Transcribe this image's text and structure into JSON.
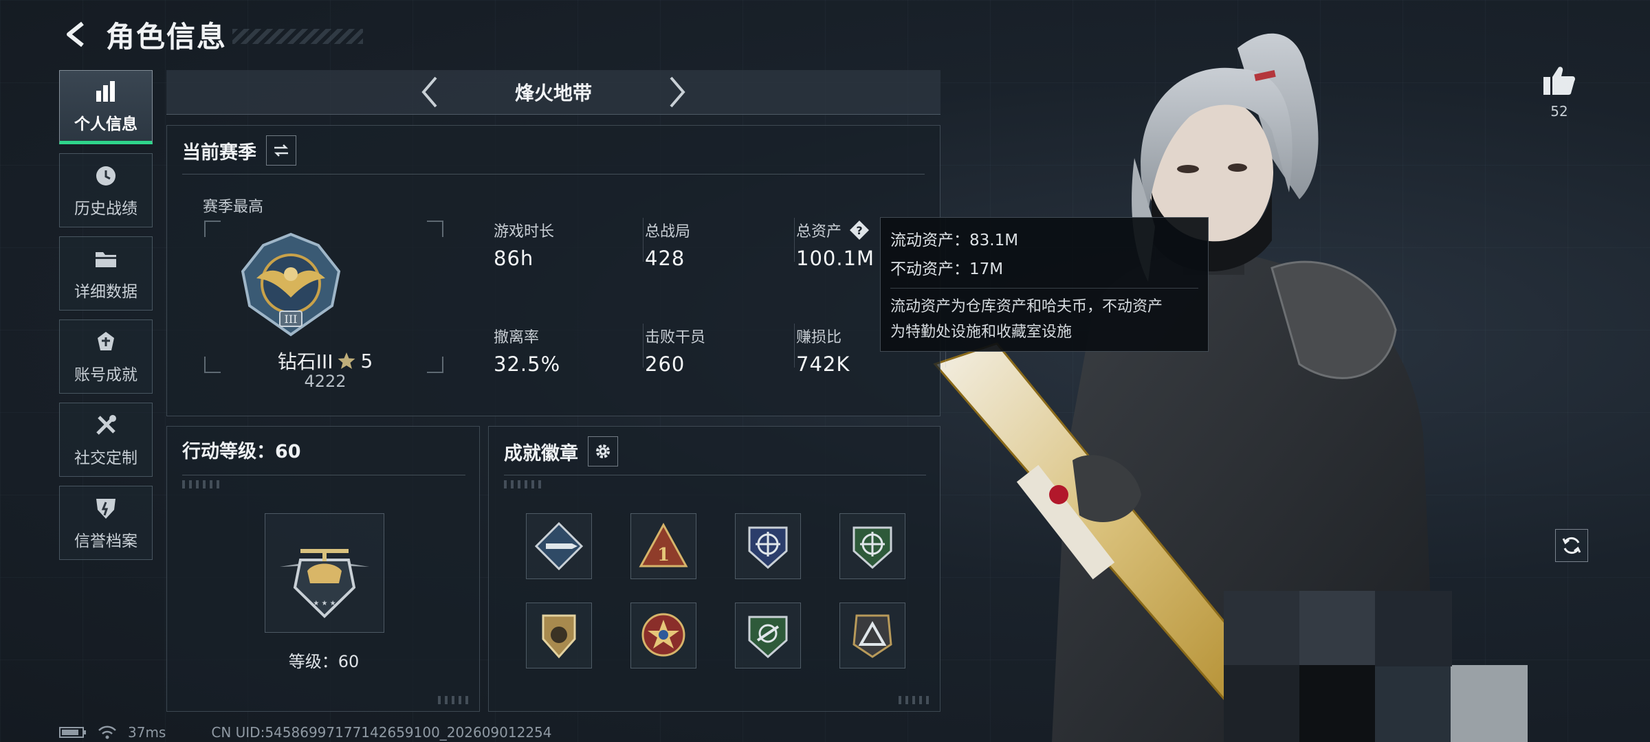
{
  "header": {
    "title": "角色信息",
    "back_icon": "back-arrow-icon"
  },
  "sidebar": {
    "items": [
      {
        "label": "个人信息",
        "icon": "bar-chart-icon",
        "active": true
      },
      {
        "label": "历史战绩",
        "icon": "history-icon",
        "active": false
      },
      {
        "label": "详细数据",
        "icon": "folder-icon",
        "active": false
      },
      {
        "label": "账号成就",
        "icon": "achievement-icon",
        "active": false
      },
      {
        "label": "社交定制",
        "icon": "tools-icon",
        "active": false
      },
      {
        "label": "信誉档案",
        "icon": "credit-shield-icon",
        "active": false
      }
    ],
    "accent_color": "#2fd58b"
  },
  "mode": {
    "name": "烽火地带"
  },
  "season": {
    "title": "当前赛季",
    "best_label": "赛季最高",
    "rank_name": "钻石III",
    "rank_stars": "5",
    "rank_score": "4222",
    "stats": [
      {
        "label": "游戏时长",
        "value": "86h"
      },
      {
        "label": "总战局",
        "value": "428"
      },
      {
        "label": "总资产",
        "value": "100.1M",
        "has_help": true
      },
      {
        "label": "撤离率",
        "value": "32.5%"
      },
      {
        "label": "击败干员",
        "value": "260"
      },
      {
        "label": "赚损比",
        "value": "742K"
      }
    ]
  },
  "tooltip": {
    "line1": "流动资产：83.1M",
    "line2": "不动资产：17M",
    "desc1": "流动资产为仓库资产和哈夫币，不动资产",
    "desc2": "为特勤处设施和收藏室设施"
  },
  "level": {
    "title": "行动等级：60",
    "caption": "等级：60"
  },
  "badges": {
    "title": "成就徽章",
    "items": [
      "missile-badge-icon",
      "rank-one-badge-icon",
      "blue-crosshair-badge-icon",
      "green-crosshair-badge-icon",
      "gold-shield-badge-icon",
      "star-medal-badge-icon",
      "green-shield-badge-icon",
      "triangle-badge-icon"
    ]
  },
  "like": {
    "count": "52"
  },
  "status": {
    "ping": "37ms",
    "uid": "CN UID:54586997177142659100_202609012254"
  }
}
